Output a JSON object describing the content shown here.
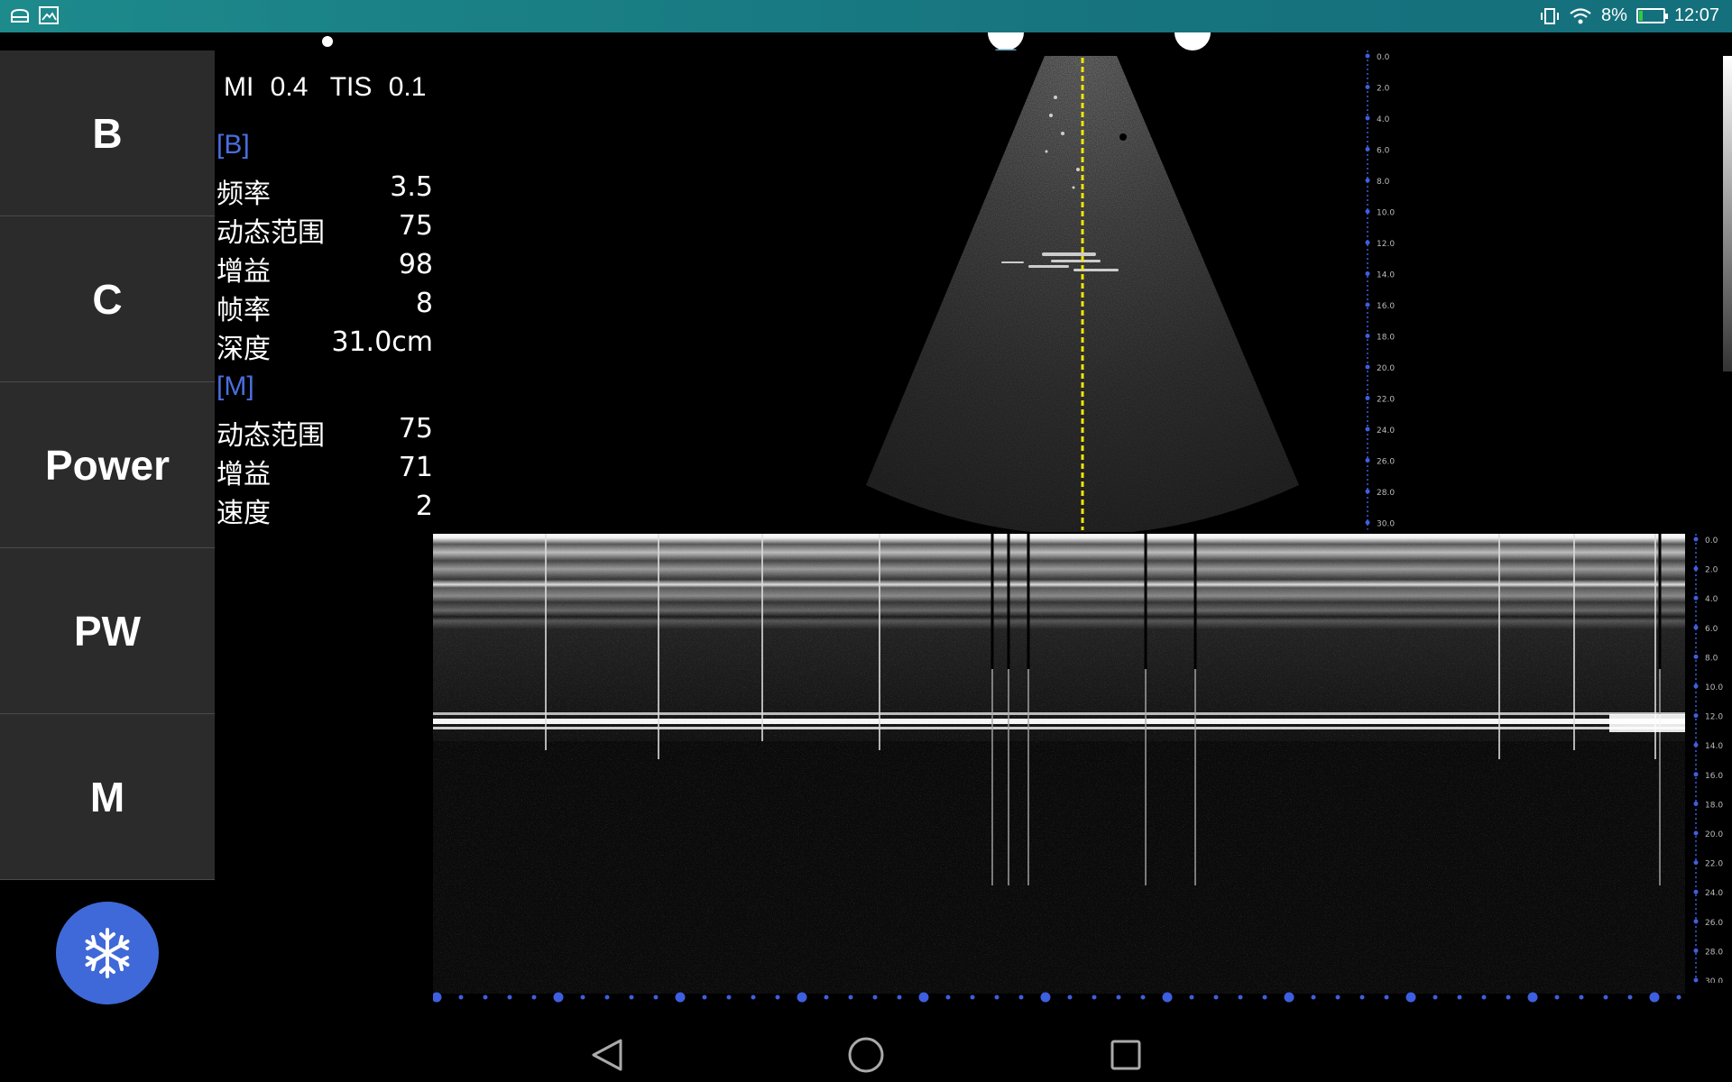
{
  "status_bar": {
    "battery": "8%",
    "time": "12:07"
  },
  "modes": {
    "b": "B",
    "c": "C",
    "power": "Power",
    "pw": "PW",
    "m": "M"
  },
  "params": {
    "mi_label": "MI",
    "mi_value": "0.4",
    "tis_label": "TIS",
    "tis_value": "0.1",
    "b_section": "[B]",
    "b_rows": [
      {
        "label": "频率",
        "value": "3.5"
      },
      {
        "label": "动态范围",
        "value": "75"
      },
      {
        "label": "增益",
        "value": "98"
      },
      {
        "label": "帧率",
        "value": "8"
      },
      {
        "label": "深度",
        "value": "31.0cm"
      }
    ],
    "m_section": "[M]",
    "m_rows": [
      {
        "label": "动态范围",
        "value": "75"
      },
      {
        "label": "增益",
        "value": "71"
      },
      {
        "label": "速度",
        "value": "2"
      }
    ]
  },
  "depth_scale_b": [
    "0.0",
    "2.0",
    "4.0",
    "6.0",
    "8.0",
    "10.0",
    "12.0",
    "14.0",
    "16.0",
    "18.0",
    "20.0",
    "22.0",
    "24.0",
    "26.0",
    "28.0",
    "30.0"
  ],
  "depth_scale_m": [
    "0.0",
    "2.0",
    "4.0",
    "6.0",
    "8.0",
    "10.0",
    "12.0",
    "14.0",
    "16.0",
    "18.0",
    "20.0",
    "22.0",
    "24.0",
    "26.0",
    "28.0",
    "30.0"
  ],
  "icons": {
    "freeze": "snowflake-icon",
    "nav_back": "back-triangle-icon",
    "nav_home": "home-circle-icon",
    "nav_recent": "recent-square-icon"
  },
  "colors": {
    "accent": "#3f69d8",
    "scale_blue": "#3e5fe0",
    "mline_yellow": "#f2e600"
  }
}
